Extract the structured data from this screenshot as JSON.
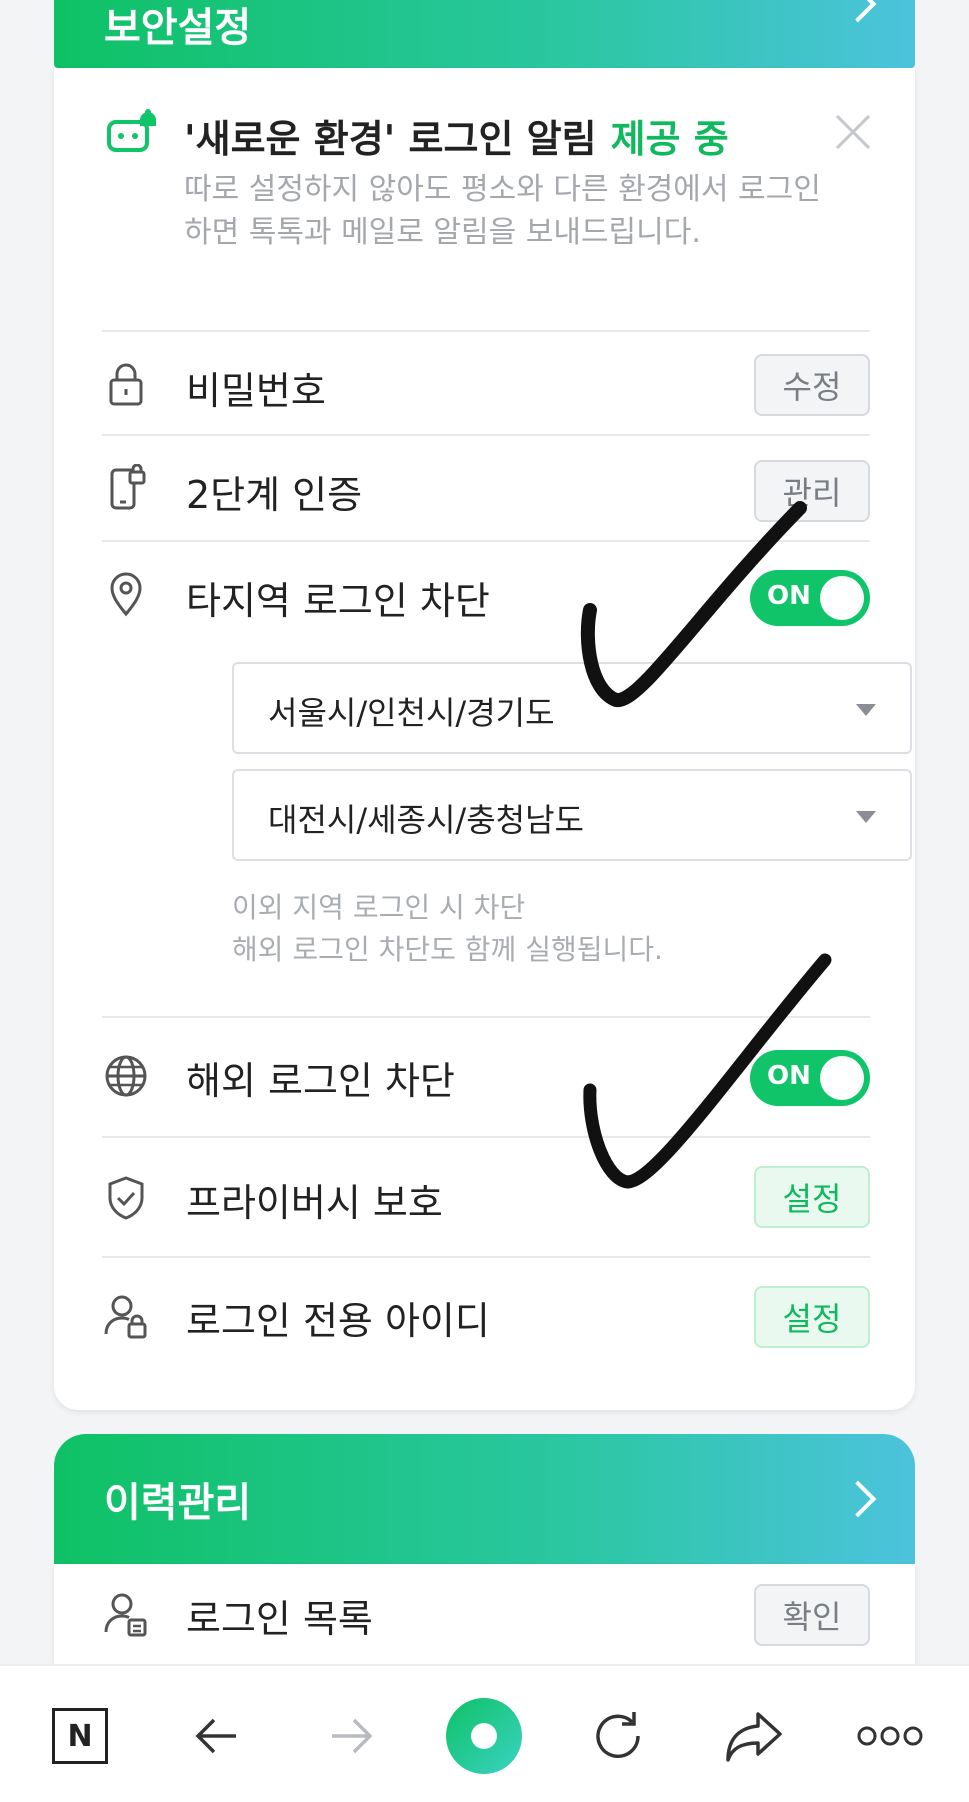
{
  "security_section": {
    "title": "보안설정",
    "notice": {
      "title": "'새로운 환경' 로그인 알림",
      "status": "제공 중",
      "description": "따로 설정하지 않아도 평소와 다른 환경에서 로그인 하면 톡톡과 메일로 알림을 보내드립니다."
    },
    "rows": {
      "password": {
        "label": "비밀번호",
        "button": "수정"
      },
      "two_factor": {
        "label": "2단계 인증",
        "button": "관리"
      },
      "region_block": {
        "label": "타지역 로그인 차단",
        "toggle": "ON",
        "regions": [
          "서울시/인천시/경기도",
          "대전시/세종시/충청남도"
        ],
        "hint_line1": "이외 지역 로그인 시 차단",
        "hint_line2": "해외 로그인 차단도 함께 실행됩니다."
      },
      "overseas_block": {
        "label": "해외 로그인 차단",
        "toggle": "ON"
      },
      "privacy": {
        "label": "프라이버시 보호",
        "button": "설정"
      },
      "login_only_id": {
        "label": "로그인 전용 아이디",
        "button": "설정"
      }
    }
  },
  "history_section": {
    "title": "이력관리",
    "rows": {
      "login_list": {
        "label": "로그인 목록",
        "button": "확인"
      }
    }
  },
  "bottom_bar": {
    "logo": "N",
    "items": [
      "naver-logo-icon",
      "back-arrow-icon",
      "forward-arrow-icon",
      "home-circle-icon",
      "refresh-icon",
      "share-icon",
      "more-icon"
    ]
  },
  "colors": {
    "brand_green": "#10c569",
    "header_gradient_end": "#4cc3dd",
    "muted_text": "#a4a8ad"
  }
}
